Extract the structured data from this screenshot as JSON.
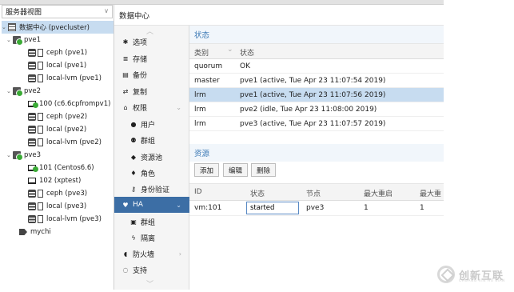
{
  "tree": {
    "view_label": "服务器视图",
    "datacenter": "数据中心 (pvecluster)",
    "nodes": [
      {
        "name": "pve1",
        "children": [
          {
            "label": "ceph (pve1)",
            "type": "storage"
          },
          {
            "label": "local (pve1)",
            "type": "storage"
          },
          {
            "label": "local-lvm (pve1)",
            "type": "storage"
          }
        ]
      },
      {
        "name": "pve2",
        "children": [
          {
            "label": "100 (c6.6cpfrompv1)",
            "type": "vm"
          },
          {
            "label": "ceph (pve2)",
            "type": "storage"
          },
          {
            "label": "local (pve2)",
            "type": "storage"
          },
          {
            "label": "local-lvm (pve2)",
            "type": "storage"
          }
        ]
      },
      {
        "name": "pve3",
        "children": [
          {
            "label": "101 (Centos6.6)",
            "type": "vm"
          },
          {
            "label": "102 (xptest)",
            "type": "vm"
          },
          {
            "label": "ceph (pve3)",
            "type": "storage"
          },
          {
            "label": "local (pve3)",
            "type": "storage"
          },
          {
            "label": "local-lvm (pve3)",
            "type": "storage"
          }
        ]
      }
    ],
    "pool": "mychi"
  },
  "header": {
    "title": "数据中心"
  },
  "nav": {
    "items": [
      {
        "label": "选项",
        "icon": "gear-icon",
        "glyph": "✱",
        "sub": false
      },
      {
        "label": "存储",
        "icon": "database-icon",
        "glyph": "≣",
        "sub": false
      },
      {
        "label": "备份",
        "icon": "floppy-icon",
        "glyph": "▤",
        "sub": false
      },
      {
        "label": "复制",
        "icon": "sync-icon",
        "glyph": "⇄",
        "sub": false
      },
      {
        "label": "权限",
        "icon": "unlock-icon",
        "glyph": "⌂",
        "sub": false,
        "caret": true
      },
      {
        "label": "用户",
        "icon": "user-icon",
        "glyph": "●",
        "sub": true
      },
      {
        "label": "群组",
        "icon": "group-icon",
        "glyph": "⚉",
        "sub": true
      },
      {
        "label": "资源池",
        "icon": "tags-icon",
        "glyph": "◆",
        "sub": true
      },
      {
        "label": "角色",
        "icon": "male-icon",
        "glyph": "♦",
        "sub": true
      },
      {
        "label": "身份验证",
        "icon": "key-icon",
        "glyph": "⚷",
        "sub": true
      },
      {
        "label": "HA",
        "icon": "heartbeat-icon",
        "glyph": "♥",
        "sub": false,
        "active": true,
        "caret": true
      },
      {
        "label": "群组",
        "icon": "object-group-icon",
        "glyph": "▣",
        "sub": true
      },
      {
        "label": "隔离",
        "icon": "bolt-icon",
        "glyph": "ϟ",
        "sub": true
      },
      {
        "label": "防火墙",
        "icon": "shield-icon",
        "glyph": "◖",
        "sub": false,
        "caret": true
      },
      {
        "label": "支持",
        "icon": "comments-icon",
        "glyph": "◌",
        "sub": false
      }
    ]
  },
  "status_panel": {
    "title": "状态",
    "headers": {
      "type": "类别",
      "status": "状态"
    },
    "rows": [
      {
        "type": "quorum",
        "status": "OK"
      },
      {
        "type": "master",
        "status": "pve1 (active, Tue Apr 23 11:07:54 2019)"
      },
      {
        "type": "lrm",
        "status": "pve1 (active, Tue Apr 23 11:07:56 2019)",
        "selected": true
      },
      {
        "type": "lrm",
        "status": "pve2 (idle, Tue Apr 23 11:08:00 2019)"
      },
      {
        "type": "lrm",
        "status": "pve3 (active, Tue Apr 23 11:07:57 2019)"
      }
    ]
  },
  "resources_panel": {
    "title": "资源",
    "buttons": {
      "add": "添加",
      "edit": "编辑",
      "remove": "删除"
    },
    "headers": {
      "id": "ID",
      "state": "状态",
      "node": "节点",
      "max_restart": "最大重启",
      "max_relocate": "最大重"
    },
    "row": {
      "id": "vm:101",
      "state": "started",
      "node": "pve3",
      "max_restart": "1",
      "max_relocate": "1"
    }
  },
  "watermark": {
    "text": "创新互联",
    "sub": "CHUANG XIN HU LIAN"
  }
}
